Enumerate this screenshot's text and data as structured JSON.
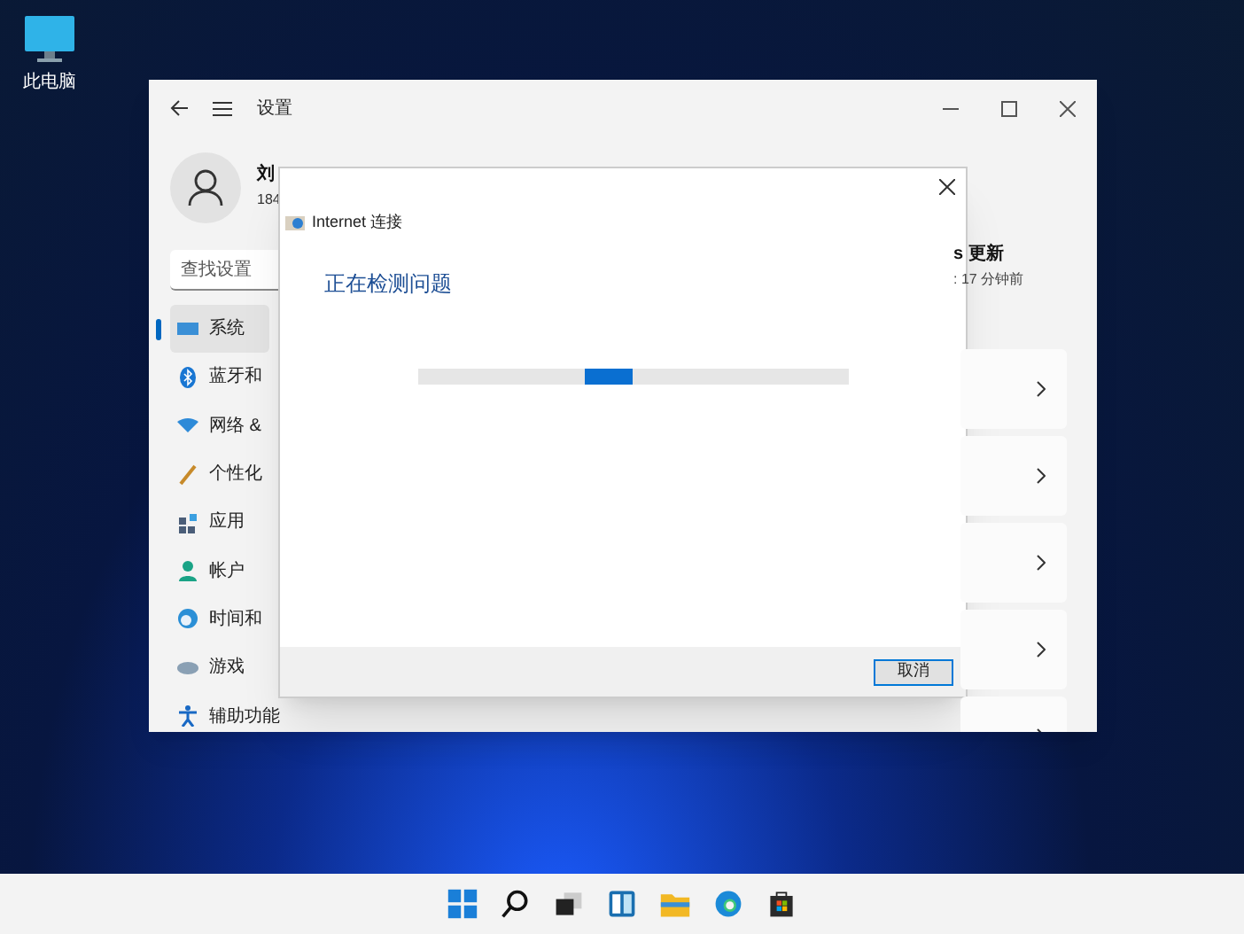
{
  "desktop_icons": [
    {
      "label": "此电脑"
    }
  ],
  "settings": {
    "title": "设置",
    "user_name": "刘",
    "user_detail": "184",
    "search": {
      "placeholder": "查找设置"
    },
    "sidebar": {
      "items": [
        {
          "label": "系统",
          "selected": true
        },
        {
          "label": "蓝牙和",
          "selected": false
        },
        {
          "label": "网络 &",
          "selected": false
        },
        {
          "label": "个性化",
          "selected": false
        },
        {
          "label": "应用",
          "selected": false
        },
        {
          "label": "帐户",
          "selected": false
        },
        {
          "label": "时间和",
          "selected": false
        },
        {
          "label": "游戏",
          "selected": false
        },
        {
          "label": "辅助功能",
          "selected": false
        }
      ]
    },
    "update": {
      "title": "s 更新",
      "subtitle": ": 17 分钟前"
    }
  },
  "dialog": {
    "title": "Internet 连接",
    "heading": "正在检测问题",
    "progress": {
      "kind": "marquee"
    },
    "buttons": [
      "取消"
    ]
  }
}
